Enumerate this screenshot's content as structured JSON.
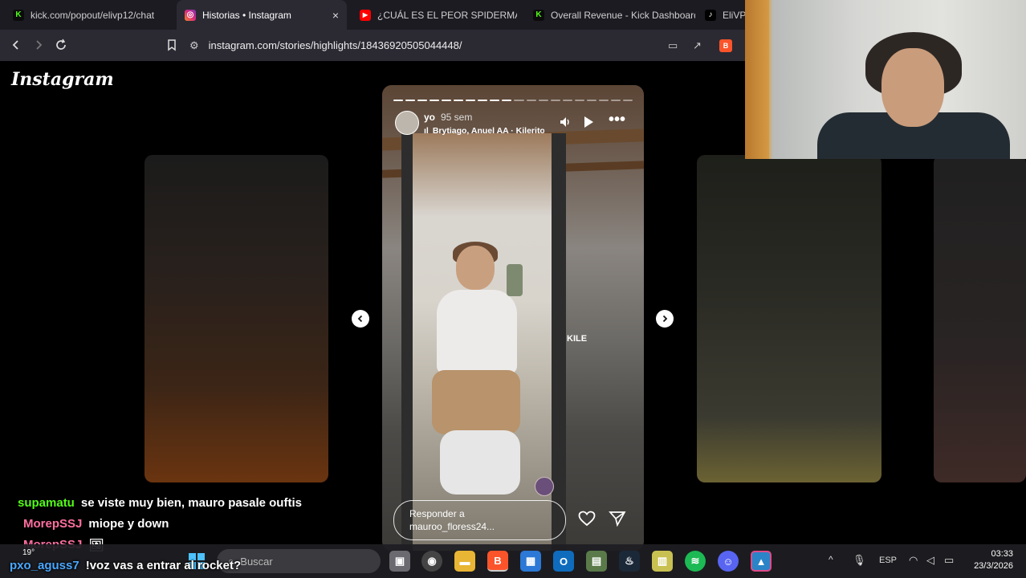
{
  "tabs": [
    {
      "label": "kick.com/popout/elivp12/chat",
      "icon": "kick-icon",
      "color": "#53fc18",
      "active": false
    },
    {
      "label": "Historias • Instagram",
      "icon": "instagram-icon",
      "color": "#e1306c",
      "active": true,
      "close": "×"
    },
    {
      "label": "¿CUÁL ES EL PEOR SPIDERMAN? -",
      "icon": "youtube-icon",
      "color": "#ff0000",
      "active": false
    },
    {
      "label": "Overall Revenue - Kick Dashboard",
      "icon": "kick-icon",
      "color": "#53fc18",
      "active": false
    },
    {
      "label": "EliVP",
      "icon": "tiktok-icon",
      "color": "#ffffff",
      "active": false
    }
  ],
  "nav": {
    "url": "instagram.com/stories/highlights/18436920505044448/"
  },
  "page": {
    "logo": "Instagram"
  },
  "story": {
    "username": "yo",
    "time": "95 sem",
    "music": "Brytiago, Anuel AA · Kilerito",
    "sticker_text": "KILE",
    "reply_placeholder_line1": "Responder a",
    "reply_placeholder_line2": "mauroo_floress24...",
    "progress_segments": 20,
    "progress_done": 10
  },
  "chat": [
    {
      "user": "supamatu",
      "color": "#53fc18",
      "msg": "se viste muy bien, mauro pasale ouftis"
    },
    {
      "user": "MorepSSJ",
      "color": "#ff6fa0",
      "msg": "miope y down"
    },
    {
      "user": "MorepSSJ",
      "color": "#ff6fa0",
      "msg": "🖼"
    },
    {
      "user": "pxo_aguss7",
      "color": "#4aa8ff",
      "msg": "!voz vas a entrar al rocket?"
    }
  ],
  "taskbar": {
    "weather": "19°",
    "search_placeholder": "Buscar",
    "lang": "ESP",
    "time": "03:33",
    "date": "23/3/2026"
  }
}
